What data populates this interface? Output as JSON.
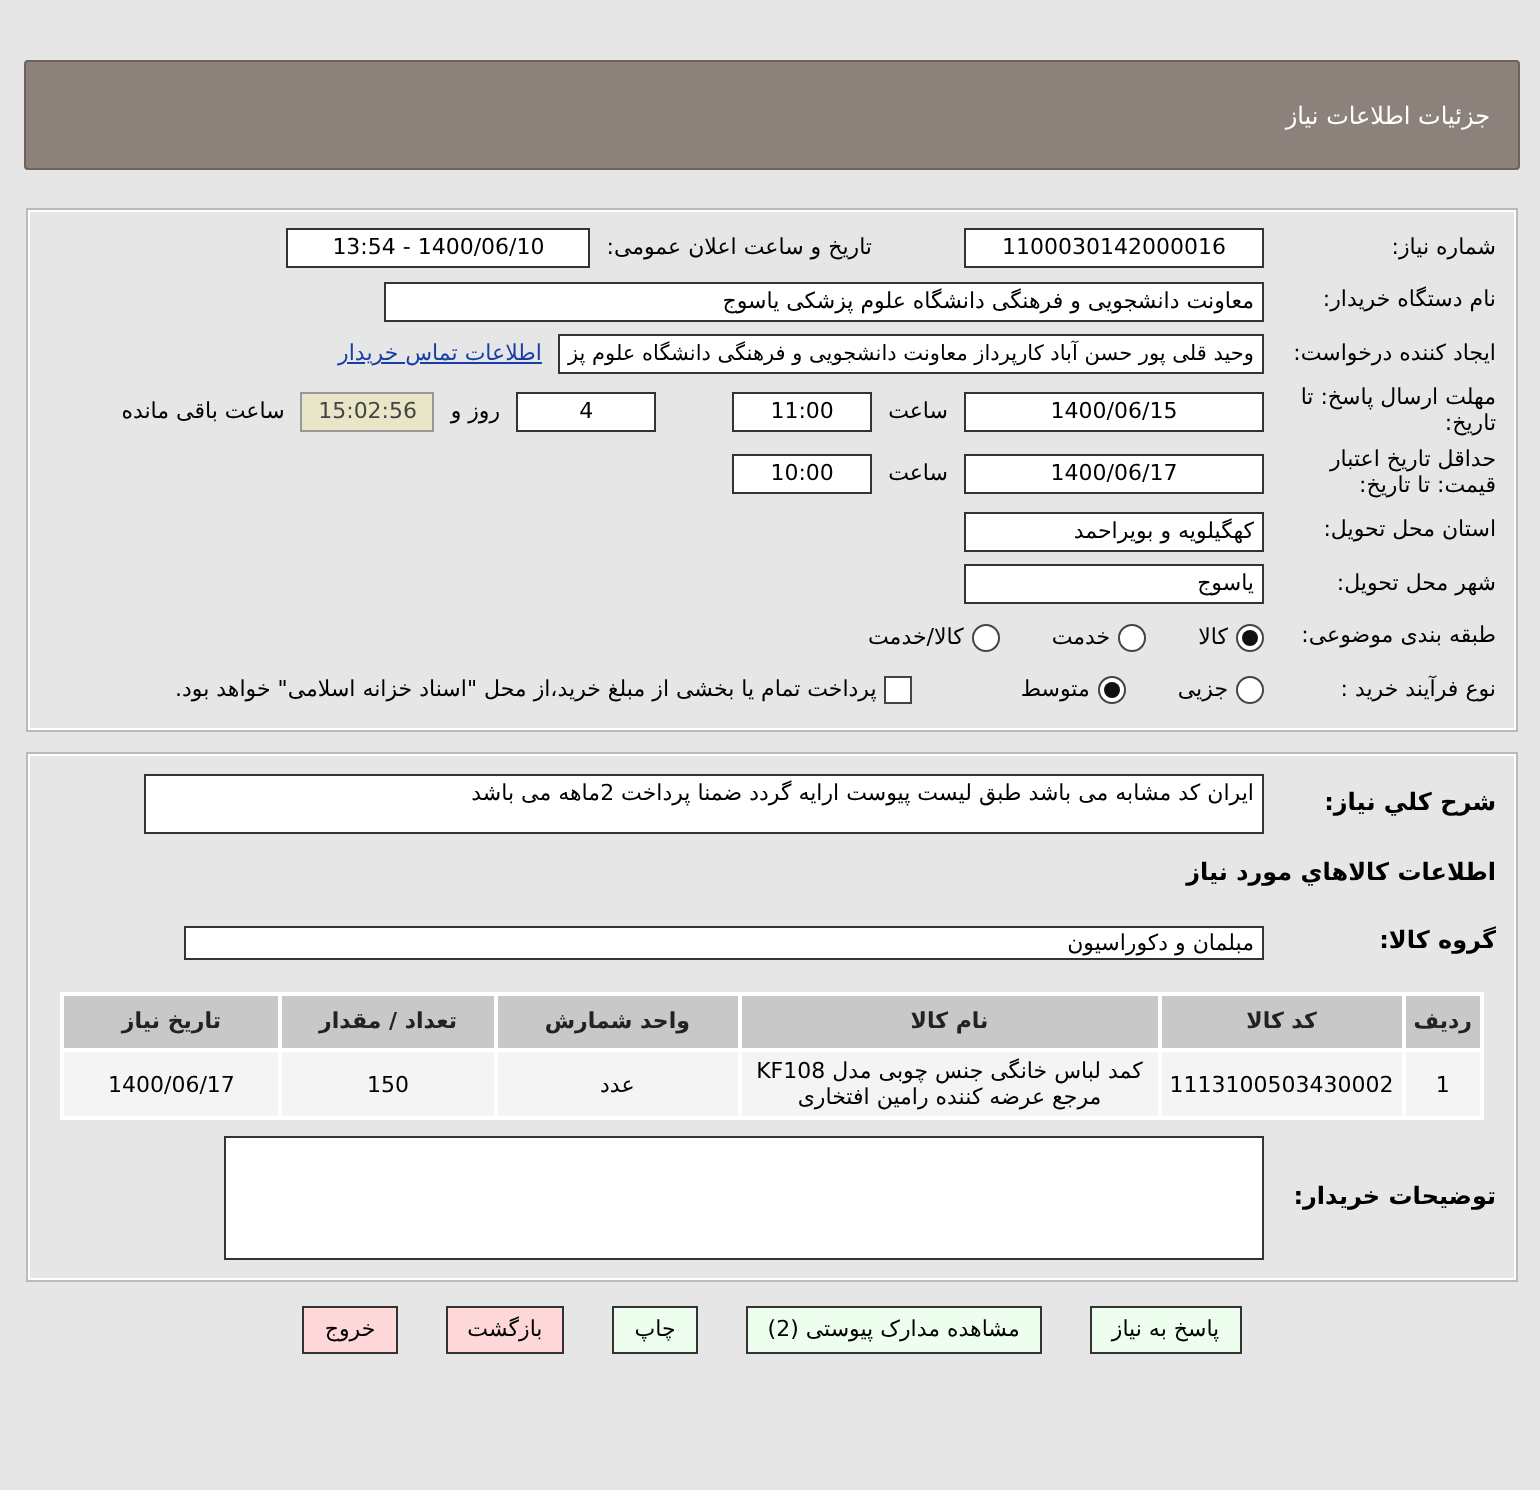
{
  "title": "جزئیات اطلاعات نیاز",
  "need_number": {
    "label": "شماره نیاز:",
    "value": "1100030142000016"
  },
  "announce": {
    "label": "تاریخ و ساعت اعلان عمومی:",
    "value": "1400/06/10 - 13:54"
  },
  "buyer_org": {
    "label": "نام دستگاه خریدار:",
    "value": "معاونت دانشجویی و فرهنگی دانشگاه علوم پزشکی یاسوج"
  },
  "requester": {
    "label": "ایجاد کننده درخواست:",
    "value": "وحید قلی پور حسن آباد کارپرداز معاونت دانشجویی و فرهنگی دانشگاه علوم پز",
    "link": "اطلاعات تماس خریدار"
  },
  "deadline": {
    "label": "مهلت ارسال پاسخ: تا تاریخ:",
    "date": "1400/06/15",
    "time_label": "ساعت",
    "time": "11:00",
    "days": "4",
    "days_label": "روز و",
    "remaining": "15:02:56",
    "remaining_label": "ساعت باقی مانده"
  },
  "validity": {
    "label": "حداقل تاریخ اعتبار قیمت: تا تاریخ:",
    "date": "1400/06/17",
    "time_label": "ساعت",
    "time": "10:00"
  },
  "province": {
    "label": "استان محل تحویل:",
    "value": "کهگیلویه و بویراحمد"
  },
  "city": {
    "label": "شهر محل تحویل:",
    "value": "یاسوج"
  },
  "category": {
    "label": "طبقه بندی موضوعی:",
    "options": [
      {
        "label": "کالا",
        "selected": true
      },
      {
        "label": "خدمت",
        "selected": false
      },
      {
        "label": "کالا/خدمت",
        "selected": false
      }
    ]
  },
  "process": {
    "label": "نوع فرآیند خرید :",
    "options": [
      {
        "label": "جزیی",
        "selected": false
      },
      {
        "label": "متوسط",
        "selected": true
      }
    ],
    "payment": {
      "label": "پرداخت تمام یا بخشی از مبلغ خرید،از محل \"اسناد خزانه اسلامی\" خواهد بود.",
      "checked": false
    }
  },
  "description": {
    "label": "شرح کلي نياز:",
    "value": "ایران کد مشابه می باشد طبق لیست پیوست ارایه گردد ضمنا پرداخت 2ماهه می باشد"
  },
  "goods_title": "اطلاعات کالاهاي مورد نياز",
  "goods_group": {
    "label": "گروه کالا:",
    "value": "مبلمان و دکوراسیون"
  },
  "table": {
    "columns": [
      "ردیف",
      "کد کالا",
      "نام کالا",
      "واحد شمارش",
      "تعداد / مقدار",
      "تاریخ نیاز"
    ],
    "rows": [
      [
        "1",
        "1113100503430002",
        "کمد لباس خانگی جنس چوبی مدل KF108 مرجع عرضه کننده رامین افتخاری",
        "عدد",
        "150",
        "1400/06/17"
      ]
    ]
  },
  "buyer_notes": {
    "label": "توضیحات خریدار:"
  },
  "buttons": [
    {
      "label": "پاسخ به نیاز",
      "kind": "action"
    },
    {
      "label": "مشاهده مدارک پیوستی (2)",
      "kind": "action"
    },
    {
      "label": "چاپ",
      "kind": "action"
    },
    {
      "label": "بازگشت",
      "kind": "exit"
    },
    {
      "label": "خروج",
      "kind": "exit"
    }
  ]
}
